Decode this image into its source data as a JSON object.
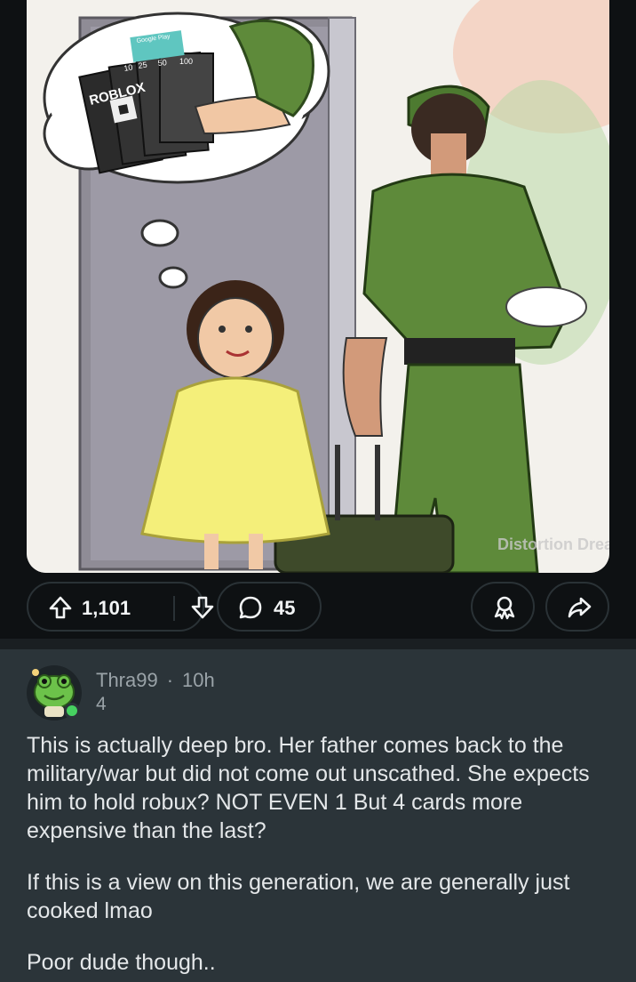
{
  "post": {
    "image_alt": "Cartoon of a girl imagining Roblox gift cards as her returning soldier father stands with a suitcase",
    "image_text": {
      "roblox_logo": "ROBLOX",
      "card_values": [
        "10",
        "25",
        "50",
        "100"
      ],
      "google_play": "Google Play",
      "watermark": "Distortion Dream"
    },
    "upvote_count": "1,101",
    "comment_count": "45",
    "icons": {
      "upvote": "arrow-up-icon",
      "downvote": "arrow-down-icon",
      "comments": "speech-bubble-icon",
      "award": "award-icon",
      "share": "share-arrow-icon"
    }
  },
  "comment": {
    "username": "Thra99",
    "separator": "·",
    "age": "10h",
    "score": "4",
    "paragraphs": [
      "This is actually deep bro. Her father comes back to the military/war but did not come out unscathed. She expects him to hold robux? NOT EVEN 1 But 4 cards more expensive than the last?",
      "If this is a view on this generation, we are generally just cooked lmao",
      "Poor dude though.."
    ],
    "avatar_icon": "frog-avatar-icon",
    "status_color": "#46d160"
  },
  "colors": {
    "background": "#0e1113",
    "comment_background": "#2b3439",
    "pill_border": "#2a3236",
    "uniform_green": "#5e8a3a",
    "dress_yellow": "#f4ef7a"
  }
}
